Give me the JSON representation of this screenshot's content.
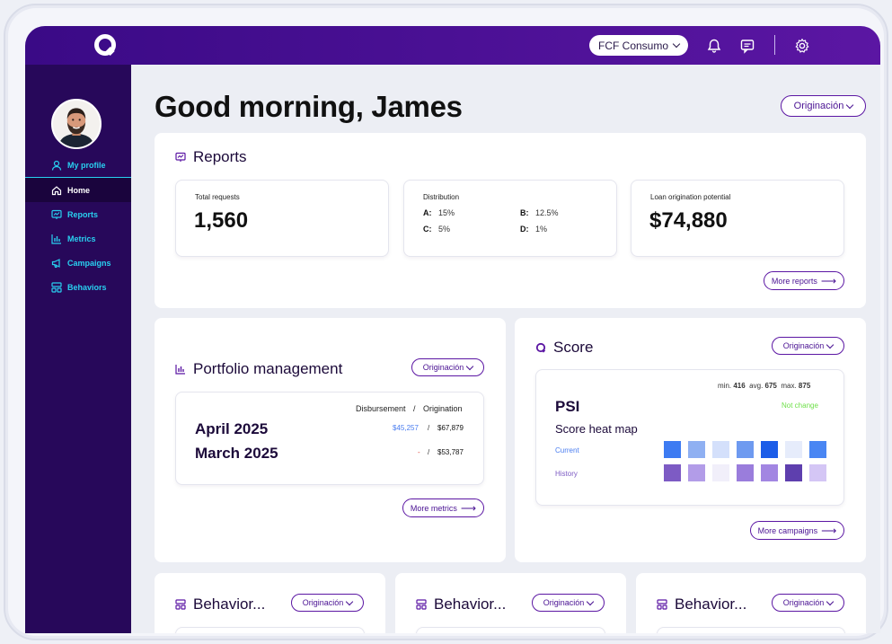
{
  "header": {
    "org_selector": "FCF Consumo",
    "icons": [
      "bell-icon",
      "message-icon",
      "gear-icon"
    ]
  },
  "sidebar": {
    "items": [
      {
        "label": "My profile",
        "icon": "user-icon"
      },
      {
        "label": "Home",
        "icon": "home-icon"
      },
      {
        "label": "Reports",
        "icon": "reports-icon"
      },
      {
        "label": "Metrics",
        "icon": "metrics-icon"
      },
      {
        "label": "Campaigns",
        "icon": "megaphone-icon"
      },
      {
        "label": "Behaviors",
        "icon": "behaviors-icon"
      }
    ]
  },
  "main": {
    "greeting": "Good morning, James",
    "filter": "Originación",
    "reports": {
      "title": "Reports",
      "total_label": "Total requests",
      "total_value": "1,560",
      "distribution_label": "Distribution",
      "distribution": {
        "a_key": "A:",
        "a_val": "15%",
        "b_key": "B:",
        "b_val": "12.5%",
        "c_key": "C:",
        "c_val": "5%",
        "d_key": "D:",
        "d_val": "1%"
      },
      "potential_label": "Loan origination potential",
      "potential_value": "$74,880",
      "more": "More reports"
    },
    "portfolio": {
      "title": "Portfolio management",
      "filter": "Originación",
      "col_disbursement": "Disbursement",
      "col_sep": "/",
      "col_origination": "Origination",
      "rows": [
        {
          "month": "April 2025",
          "disbursement": "$45,257",
          "sep": "/",
          "origination": "$67,879"
        },
        {
          "month": "March 2025",
          "disbursement": "-",
          "sep": "/",
          "origination": "$53,787"
        }
      ],
      "more": "More metrics"
    },
    "score": {
      "title": "Score",
      "filter": "Originación",
      "min_label": "min.",
      "min_value": "416",
      "avg_label": "avg.",
      "avg_value": "675",
      "max_label": "max.",
      "max_value": "875",
      "psi": "PSI",
      "status": "Not change",
      "heatmap_title": "Score heat map",
      "current_label": "Current",
      "history_label": "History",
      "current_colors": [
        "#3d7bf2",
        "#8fb0f2",
        "#d4e0fb",
        "#6e9af0",
        "#1c5de8",
        "#e6ecfb",
        "#4a86f3"
      ],
      "history_colors": [
        "#7d5bc4",
        "#b29ce8",
        "#f1effa",
        "#9a7ddc",
        "#a286e2",
        "#5e3fae",
        "#d4c6f5"
      ],
      "more": "More campaigns"
    },
    "behaviors": [
      {
        "title": "Behavior...",
        "filter": "Originación"
      },
      {
        "title": "Behavior...",
        "filter": "Originación"
      },
      {
        "title": "Behavior...",
        "filter": "Originación"
      }
    ]
  },
  "colors": {
    "brand": "#5b16a3",
    "accent": "#28d0f0",
    "sidebar": "#27085a",
    "status_ok": "#6fe04a"
  }
}
